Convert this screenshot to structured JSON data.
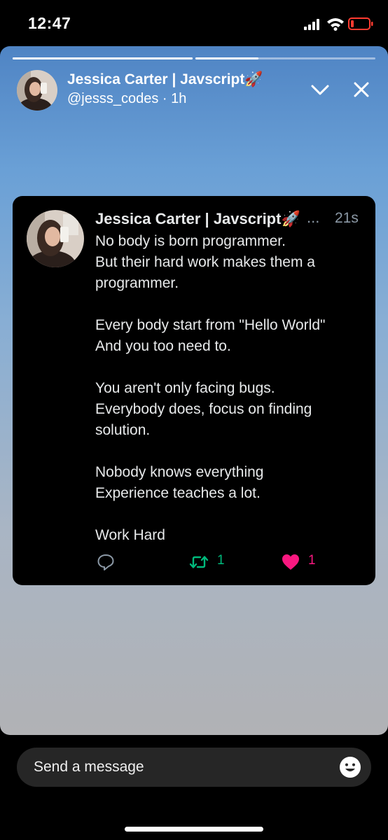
{
  "status_bar": {
    "time": "12:47"
  },
  "story": {
    "progress": [
      1.0,
      0.35
    ],
    "author_name": "Jessica Carter | Javscript🚀",
    "handle_time": "@jesss_codes · 1h"
  },
  "tweet": {
    "author_name": "Jessica Carter | Javscript🚀",
    "more": "...",
    "time": "21s",
    "text": "No body is born programmer.\nBut their hard work makes them a programmer.\n\nEvery body start from \"Hello World\"\nAnd you too need to.\n\nYou aren't only facing bugs.\nEverybody does, focus on finding solution.\n\nNobody knows everything\nExperience teaches a lot.\n\nWork Hard",
    "retweets": "1",
    "likes": "1"
  },
  "message": {
    "placeholder": "Send a message"
  },
  "icons": {
    "chevron": "chevron-down-icon",
    "close": "close-icon",
    "reply": "reply-icon",
    "retweet": "retweet-icon",
    "like": "heart-icon",
    "emoji": "smiley-icon"
  },
  "colors": {
    "retweet": "#00ba7c",
    "like": "#f91880",
    "battery_low": "#ff3b30"
  }
}
